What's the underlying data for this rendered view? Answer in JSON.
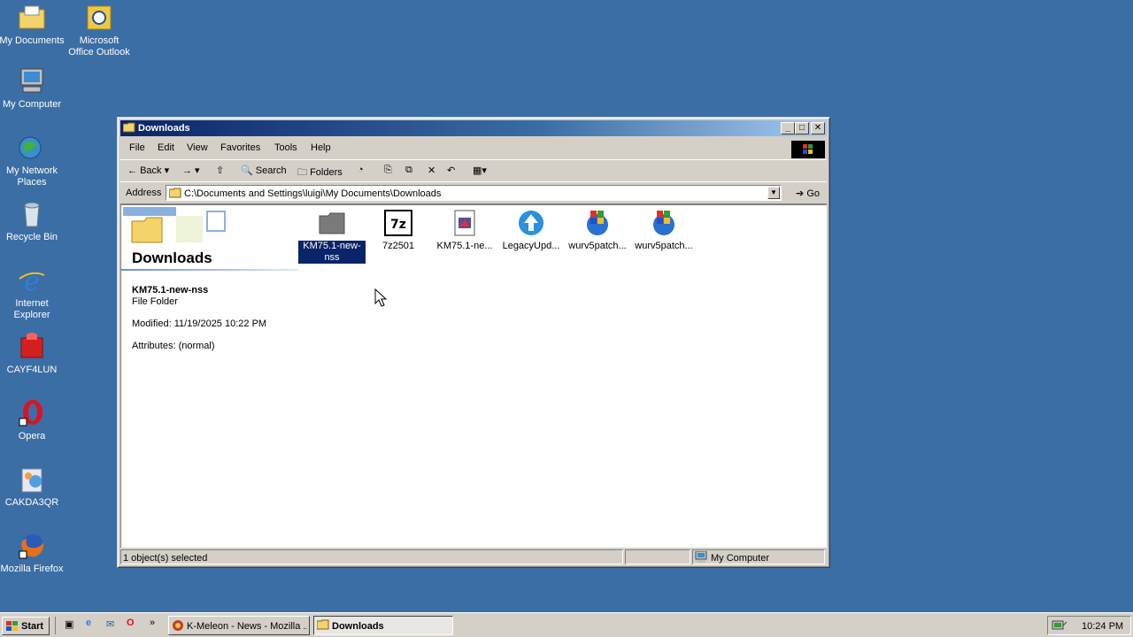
{
  "desktop": {
    "icons": [
      {
        "label": "My Documents"
      },
      {
        "label": "Microsoft Office Outlook"
      },
      {
        "label": "My Computer"
      },
      {
        "label": "My Network Places"
      },
      {
        "label": "Recycle Bin"
      },
      {
        "label": "Internet Explorer"
      },
      {
        "label": "CAYF4LUN"
      },
      {
        "label": "Opera"
      },
      {
        "label": "CAKDA3QR"
      },
      {
        "label": "Mozilla Firefox"
      }
    ]
  },
  "window": {
    "title": "Downloads",
    "menu": [
      "File",
      "Edit",
      "View",
      "Favorites",
      "Tools",
      "Help"
    ],
    "toolbar": {
      "back": "Back",
      "search": "Search",
      "folders": "Folders"
    },
    "address": {
      "label": "Address",
      "value": "C:\\Documents and Settings\\luigi\\My Documents\\Downloads",
      "go": "Go"
    },
    "webview": {
      "title": "Downloads",
      "selected_name": "KM75.1-new-nss",
      "selected_type": "File Folder",
      "modified": "Modified: 11/19/2025 10:22 PM",
      "attributes": "Attributes: (normal)"
    },
    "files": [
      {
        "label": "KM75.1-new-nss",
        "icon": "folder-icon",
        "selected": true
      },
      {
        "label": "7z2501",
        "icon": "7zip-icon"
      },
      {
        "label": "KM75.1-ne...",
        "icon": "installer-icon"
      },
      {
        "label": "LegacyUpd...",
        "icon": "legacy-update-icon"
      },
      {
        "label": "wurv5patch...",
        "icon": "windows-update-icon"
      },
      {
        "label": "wurv5patch...",
        "icon": "windows-update-icon"
      }
    ],
    "status": {
      "selected": "1 object(s) selected",
      "zone": "My Computer"
    }
  },
  "taskbar": {
    "start": "Start",
    "tasks": [
      {
        "label": "K-Meleon - News - Mozilla ...",
        "active": false
      },
      {
        "label": "Downloads",
        "active": true
      }
    ],
    "clock": "10:24 PM"
  },
  "colors": {
    "desktop": "#3a6ea5",
    "titlebar": "#0a246a",
    "selection": "#0a246a"
  }
}
